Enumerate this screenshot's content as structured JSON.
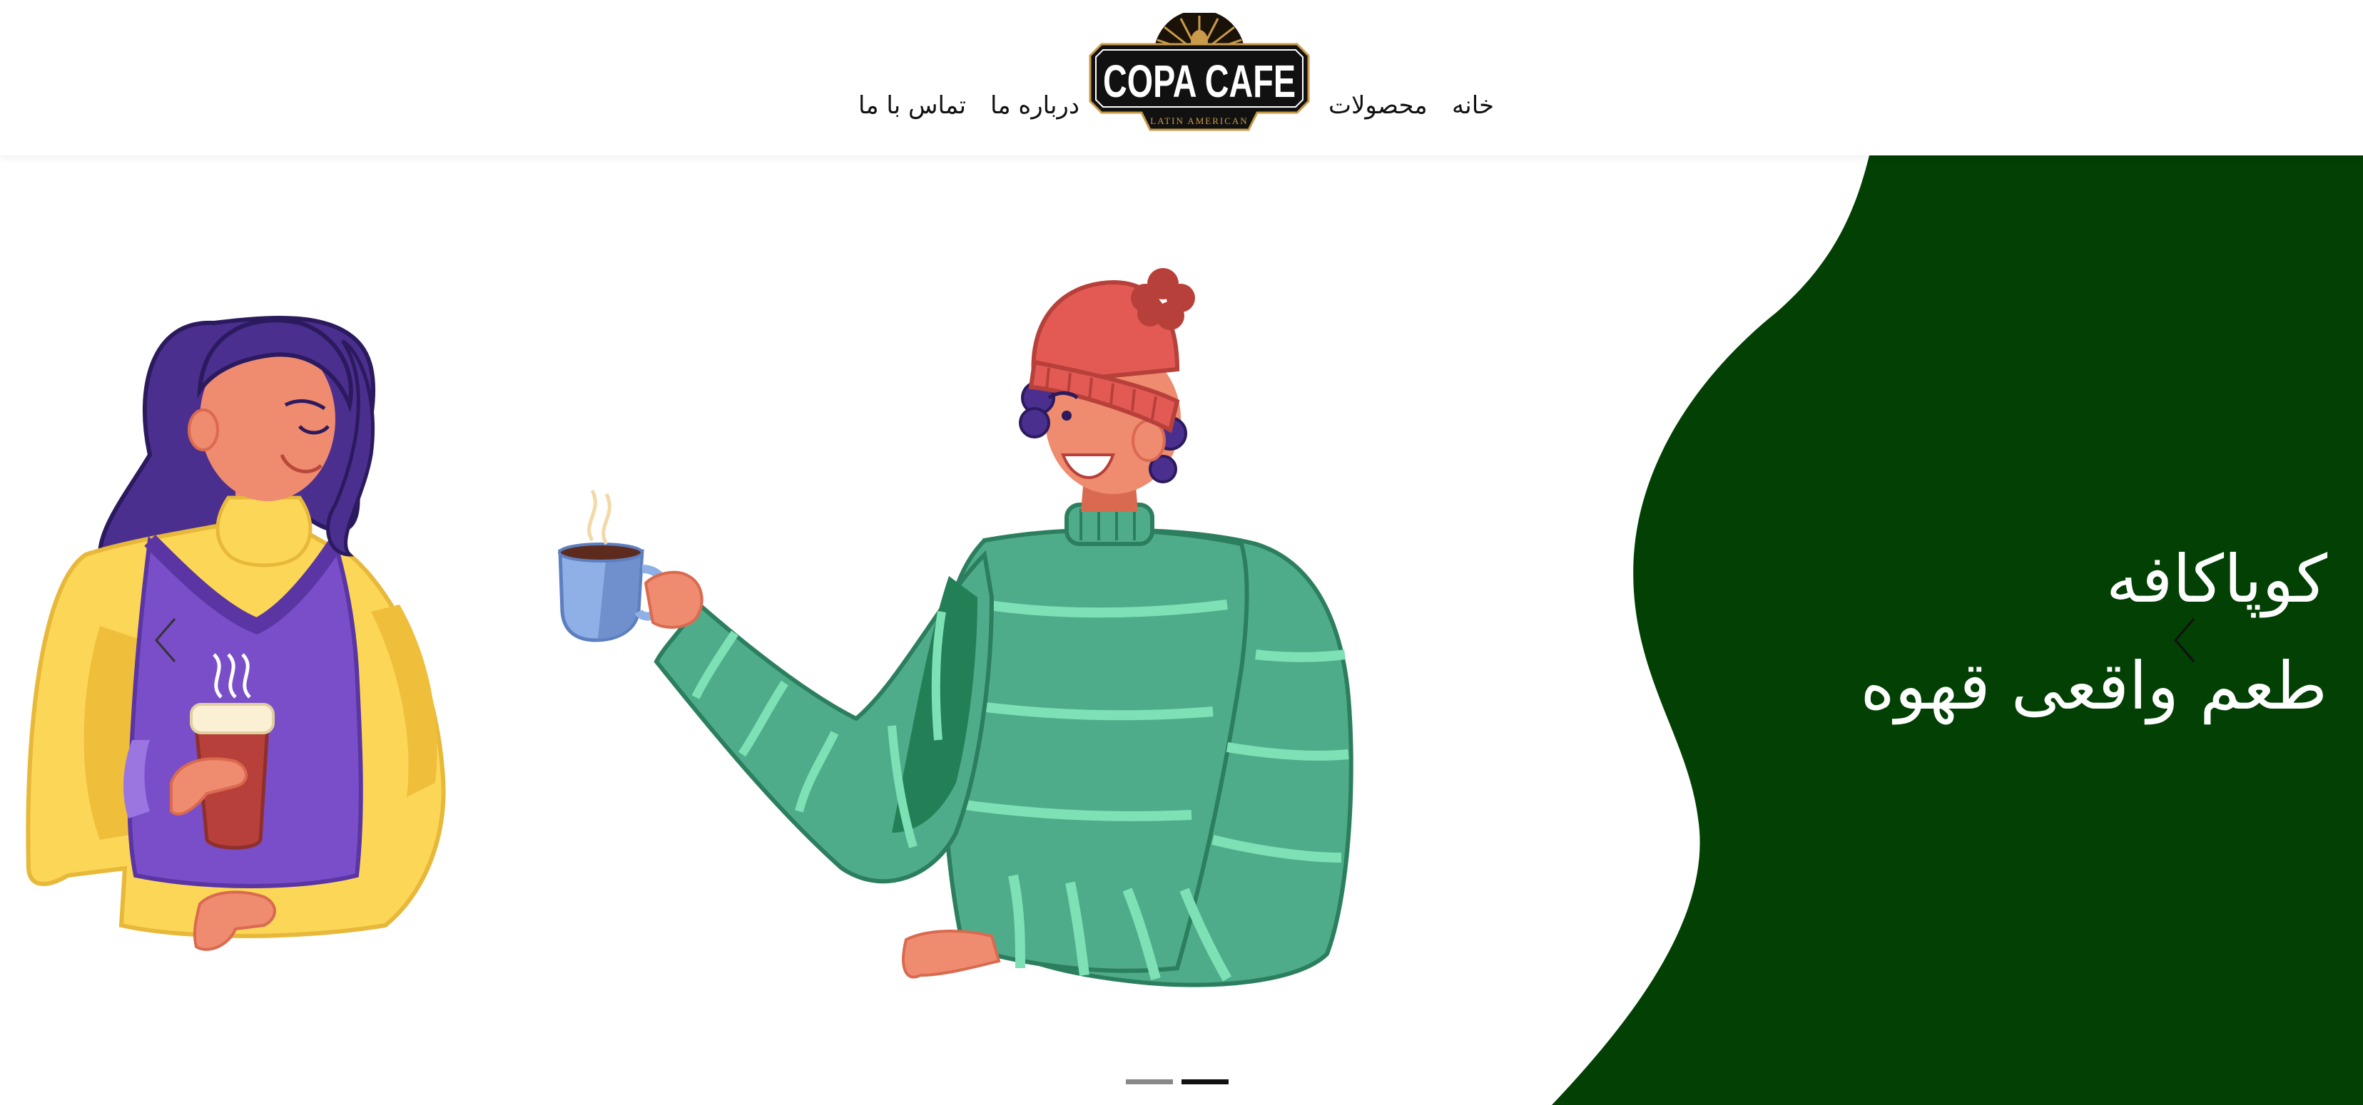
{
  "header": {
    "logo": {
      "brand_text": "COPA CAFE",
      "tagline": "LATIN AMERICAN"
    },
    "nav": {
      "home": "خانه",
      "products": "محصولات",
      "about": "درباره ما",
      "contact": "تماس با ما"
    }
  },
  "hero": {
    "title_line1": "کوپاکافه",
    "title_line2": "طعم واقعی قهوه",
    "background_color": "#024004",
    "slides_count": 2,
    "active_slide": 2
  },
  "icons": {
    "prev": "chevron-left-icon",
    "next": "chevron-left-icon"
  }
}
